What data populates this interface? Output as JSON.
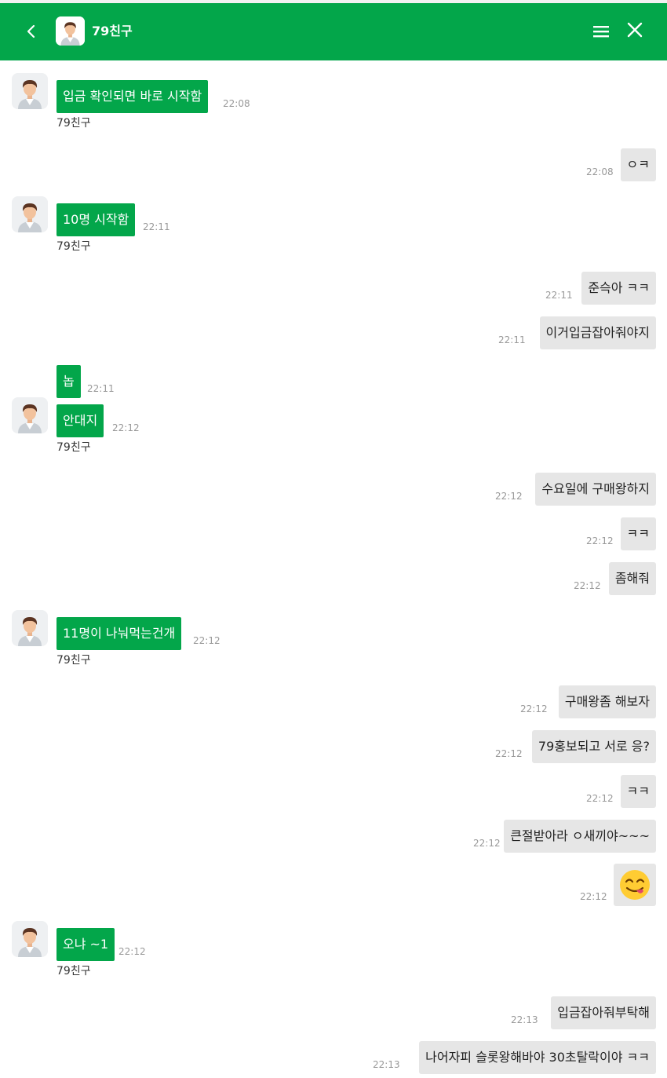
{
  "header": {
    "title": "79친구",
    "bg_color": "#03a64a"
  },
  "messages": [
    {
      "dir": "in",
      "text": "입금 확인되면 바로 시작함",
      "time": "22:08",
      "name": "79친구"
    },
    {
      "dir": "out",
      "text": "ㅇㅋ",
      "time": "22:08"
    },
    {
      "dir": "in",
      "text": "10명 시작함",
      "time": "22:11",
      "name": "79친구"
    },
    {
      "dir": "out",
      "text": "준슥아 ㅋㅋ",
      "time": "22:11"
    },
    {
      "dir": "out",
      "text": "이거입금잡아줘야지",
      "time": "22:11"
    },
    {
      "dir": "in",
      "text": "놉",
      "time": "22:11"
    },
    {
      "dir": "in",
      "text": "안대지",
      "time": "22:12",
      "name": "79친구"
    },
    {
      "dir": "out",
      "text": "수요일에 구매왕하지",
      "time": "22:12"
    },
    {
      "dir": "out",
      "text": "ㅋㅋ",
      "time": "22:12"
    },
    {
      "dir": "out",
      "text": "좀해줘",
      "time": "22:12"
    },
    {
      "dir": "in",
      "text": "11명이 나눠먹는건개",
      "time": "22:12",
      "name": "79친구"
    },
    {
      "dir": "out",
      "text": "구매왕좀 해보자",
      "time": "22:12"
    },
    {
      "dir": "out",
      "text": "79홍보되고 서로 응?",
      "time": "22:12"
    },
    {
      "dir": "out",
      "text": "ㅋㅋ",
      "time": "22:12"
    },
    {
      "dir": "out",
      "text": "큰절받아라 ㅇ새끼야~~~",
      "time": "22:12"
    },
    {
      "dir": "out",
      "emoji": "yum-face",
      "time": "22:12"
    },
    {
      "dir": "in",
      "text": "오냐 ~1",
      "time": "22:12",
      "name": "79친구"
    },
    {
      "dir": "out",
      "text": "입금잡아줘부탁해",
      "time": "22:13"
    },
    {
      "dir": "out",
      "text": "나어자피 슬롯왕해바야 30초탈락이야 ㅋㅋ",
      "time": "22:13"
    }
  ]
}
